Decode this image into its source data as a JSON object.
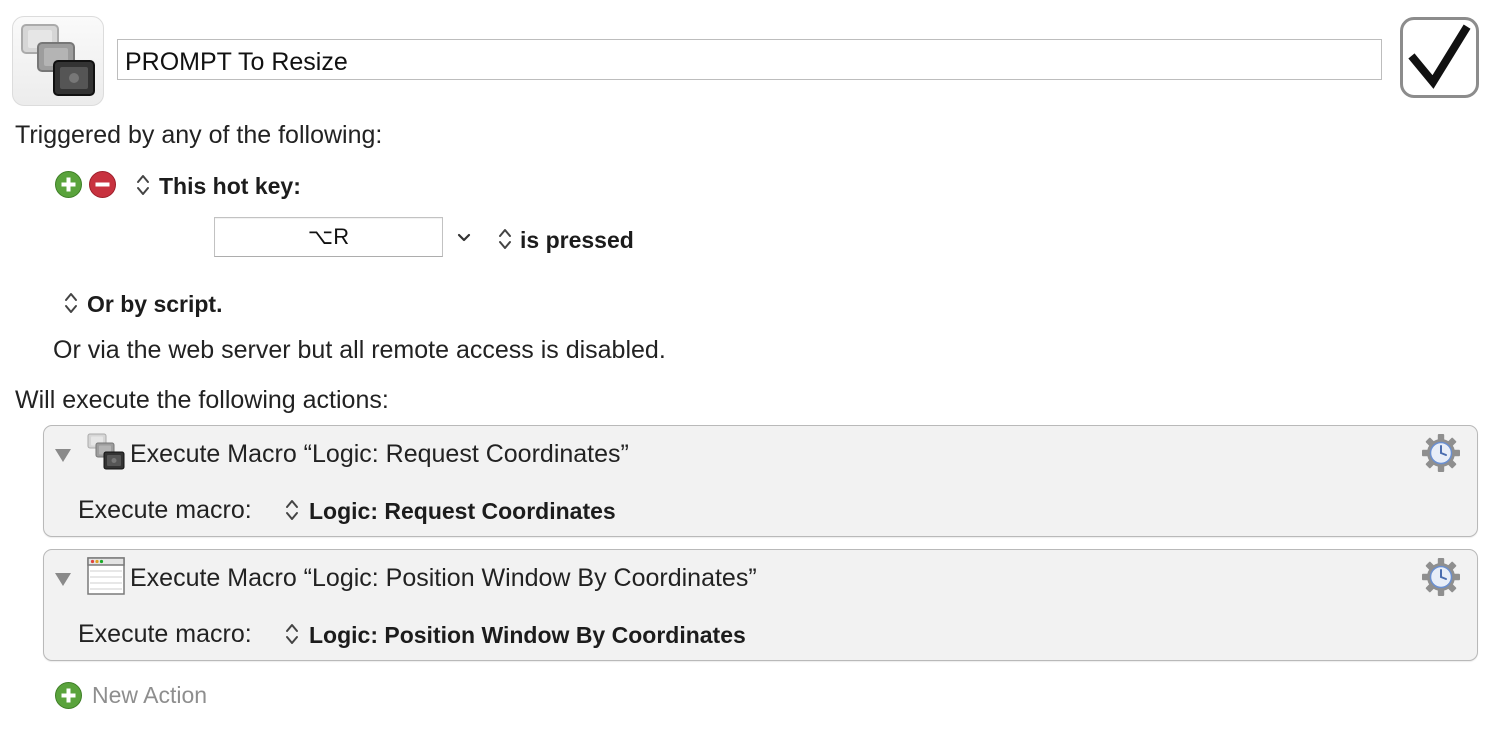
{
  "macro": {
    "icon": "macro-windows-icon",
    "name": "PROMPT To Resize",
    "enabled": true
  },
  "triggers": {
    "heading": "Triggered by any of the following:",
    "hotkey": {
      "type_label": "This hot key:",
      "key": "⌥R",
      "state": "is pressed"
    },
    "script_label": "Or by script.",
    "web_server_text": "Or via the web server but all remote access is disabled."
  },
  "actions": {
    "heading": "Will execute the following actions:",
    "items": [
      {
        "icon": "macro-windows-icon",
        "title": "Execute Macro “Logic: Request Coordinates”",
        "param_label": "Execute macro:",
        "param_value": "Logic: Request Coordinates"
      },
      {
        "icon": "window-icon",
        "title": "Execute Macro “Logic: Position Window By Coordinates”",
        "param_label": "Execute macro:",
        "param_value": "Logic: Position Window By Coordinates"
      }
    ],
    "new_action_label": "New Action"
  },
  "colors": {
    "add_green": "#5aa33c",
    "remove_red": "#c8323f",
    "gear_gray": "#8f8f8f",
    "clock_blue": "#6a8fd0"
  }
}
